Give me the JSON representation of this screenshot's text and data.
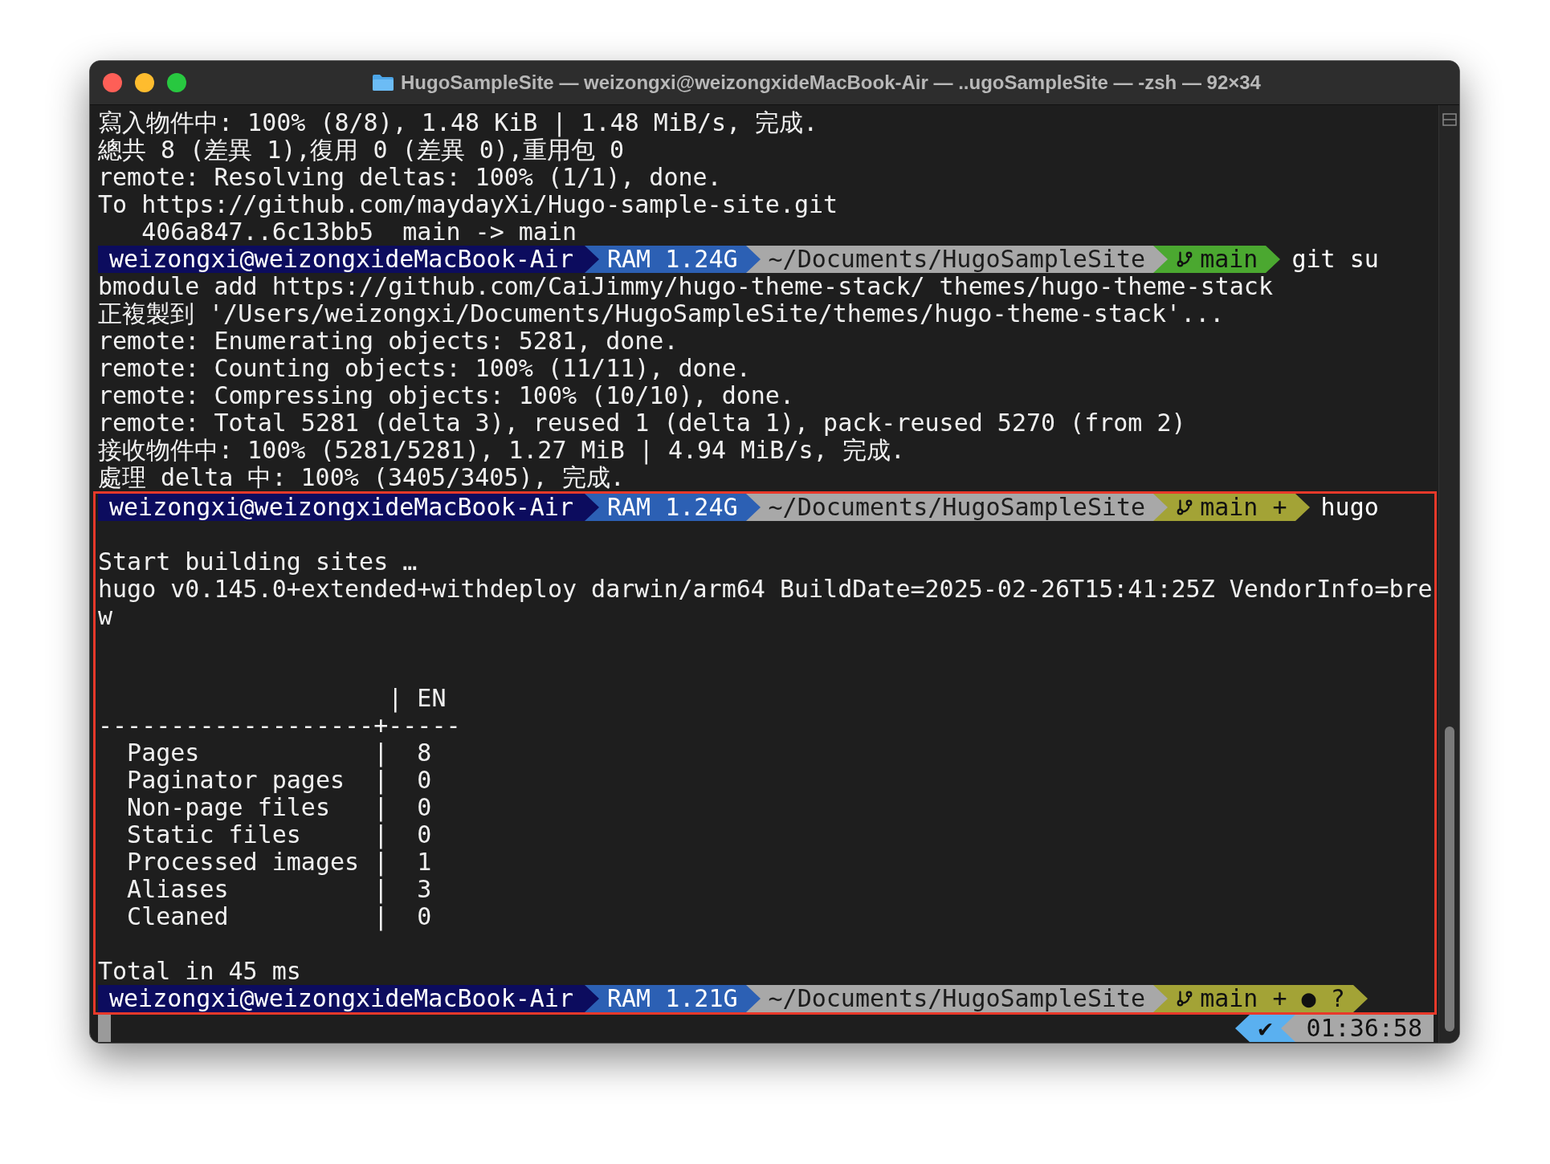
{
  "window": {
    "title": "HugoSampleSite — weizongxi@weizongxideMacBook-Air — ..ugoSampleSite — -zsh — 92×34"
  },
  "lines": [
    {
      "kind": "text",
      "text": "寫入物件中: 100% (8/8), 1.48 KiB | 1.48 MiB/s, 完成."
    },
    {
      "kind": "text",
      "text": "總共 8 (差異 1),復用 0 (差異 0),重用包 0"
    },
    {
      "kind": "text",
      "text": "remote: Resolving deltas: 100% (1/1), done."
    },
    {
      "kind": "text",
      "text": "To https://github.com/maydayXi/Hugo-sample-site.git"
    },
    {
      "kind": "text",
      "text": "   406a847..6c13bb5  main -> main"
    },
    {
      "kind": "prompt",
      "user": "weizongxi@weizongxideMacBook-Air",
      "ram": "RAM 1.24G",
      "path": "~/Documents/HugoSampleSite",
      "git": "main",
      "color": "#4ba830",
      "command": "git su"
    },
    {
      "kind": "text",
      "text": "bmodule add https://github.com/CaiJimmy/hugo-theme-stack/ themes/hugo-theme-stack"
    },
    {
      "kind": "text",
      "text": "正複製到 '/Users/weizongxi/Documents/HugoSampleSite/themes/hugo-theme-stack'..."
    },
    {
      "kind": "text",
      "text": "remote: Enumerating objects: 5281, done."
    },
    {
      "kind": "text",
      "text": "remote: Counting objects: 100% (11/11), done."
    },
    {
      "kind": "text",
      "text": "remote: Compressing objects: 100% (10/10), done."
    },
    {
      "kind": "text",
      "text": "remote: Total 5281 (delta 3), reused 1 (delta 1), pack-reused 5270 (from 2)"
    },
    {
      "kind": "text",
      "text": "接收物件中: 100% (5281/5281), 1.27 MiB | 4.94 MiB/s, 完成."
    },
    {
      "kind": "text",
      "text": "處理 delta 中: 100% (3405/3405), 完成."
    }
  ],
  "highlighted_lines": [
    {
      "kind": "prompt",
      "user": "weizongxi@weizongxideMacBook-Air",
      "ram": "RAM 1.24G",
      "path": "~/Documents/HugoSampleSite",
      "git": "main +",
      "color": "#a3a336",
      "command": "hugo"
    },
    {
      "kind": "blank"
    },
    {
      "kind": "text",
      "text": "Start building sites … "
    },
    {
      "kind": "text",
      "text": "hugo v0.145.0+extended+withdeploy darwin/arm64 BuildDate=2025-02-26T15:41:25Z VendorInfo=bre"
    },
    {
      "kind": "text",
      "text": "w"
    },
    {
      "kind": "blank"
    },
    {
      "kind": "blank"
    },
    {
      "kind": "text",
      "text": "                    | EN  "
    },
    {
      "kind": "text",
      "text": "-------------------+-----"
    },
    {
      "kind": "text",
      "text": "  Pages            |  8  "
    },
    {
      "kind": "text",
      "text": "  Paginator pages  |  0  "
    },
    {
      "kind": "text",
      "text": "  Non-page files   |  0  "
    },
    {
      "kind": "text",
      "text": "  Static files     |  0  "
    },
    {
      "kind": "text",
      "text": "  Processed images |  1  "
    },
    {
      "kind": "text",
      "text": "  Aliases          |  3  "
    },
    {
      "kind": "text",
      "text": "  Cleaned          |  0  "
    },
    {
      "kind": "blank"
    },
    {
      "kind": "text",
      "text": "Total in 45 ms"
    },
    {
      "kind": "prompt",
      "user": "weizongxi@weizongxideMacBook-Air",
      "ram": "RAM 1.21G",
      "path": "~/Documents/HugoSampleSite",
      "git": "main + ● ?",
      "color": "#a3a336"
    }
  ],
  "status": {
    "check": "✔",
    "time": "01:36:58"
  }
}
